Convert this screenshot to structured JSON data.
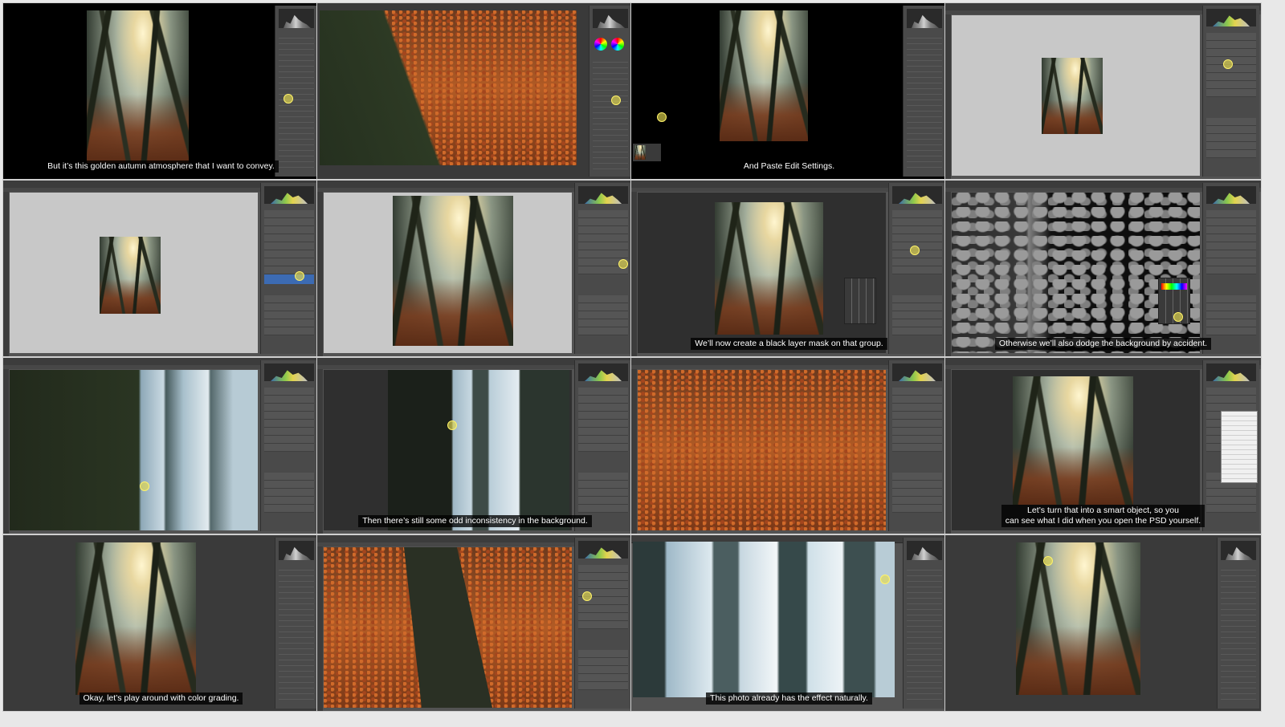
{
  "tiles": [
    {
      "id": 1,
      "subtitle": "But it’s this golden autumn atmosphere that I want to convey."
    },
    {
      "id": 2,
      "subtitle": ""
    },
    {
      "id": 3,
      "subtitle": "And Paste Edit Settings."
    },
    {
      "id": 4,
      "subtitle": ""
    },
    {
      "id": 5,
      "subtitle": ""
    },
    {
      "id": 6,
      "subtitle": ""
    },
    {
      "id": 7,
      "subtitle": "We’ll now create a black layer mask on that group."
    },
    {
      "id": 8,
      "subtitle": "Otherwise we’ll also dodge the background by accident."
    },
    {
      "id": 9,
      "subtitle": ""
    },
    {
      "id": 10,
      "subtitle": "Then there’s still some odd inconsistency in the background."
    },
    {
      "id": 11,
      "subtitle": ""
    },
    {
      "id": 12,
      "subtitle": "Let’s turn that into a smart object, so you\ncan see what I did when you open the PSD yourself."
    },
    {
      "id": 13,
      "subtitle": "Okay, let’s play around with color grading."
    },
    {
      "id": 14,
      "subtitle": ""
    },
    {
      "id": 15,
      "subtitle": "This photo already has the effect naturally."
    },
    {
      "id": 16,
      "subtitle": ""
    }
  ],
  "colors": {
    "app_background": "#535353",
    "panel": "#4a4a4a",
    "subtitle_bg": "#000000",
    "subtitle_text": "#ffffff",
    "cursor": "#fff36a"
  }
}
